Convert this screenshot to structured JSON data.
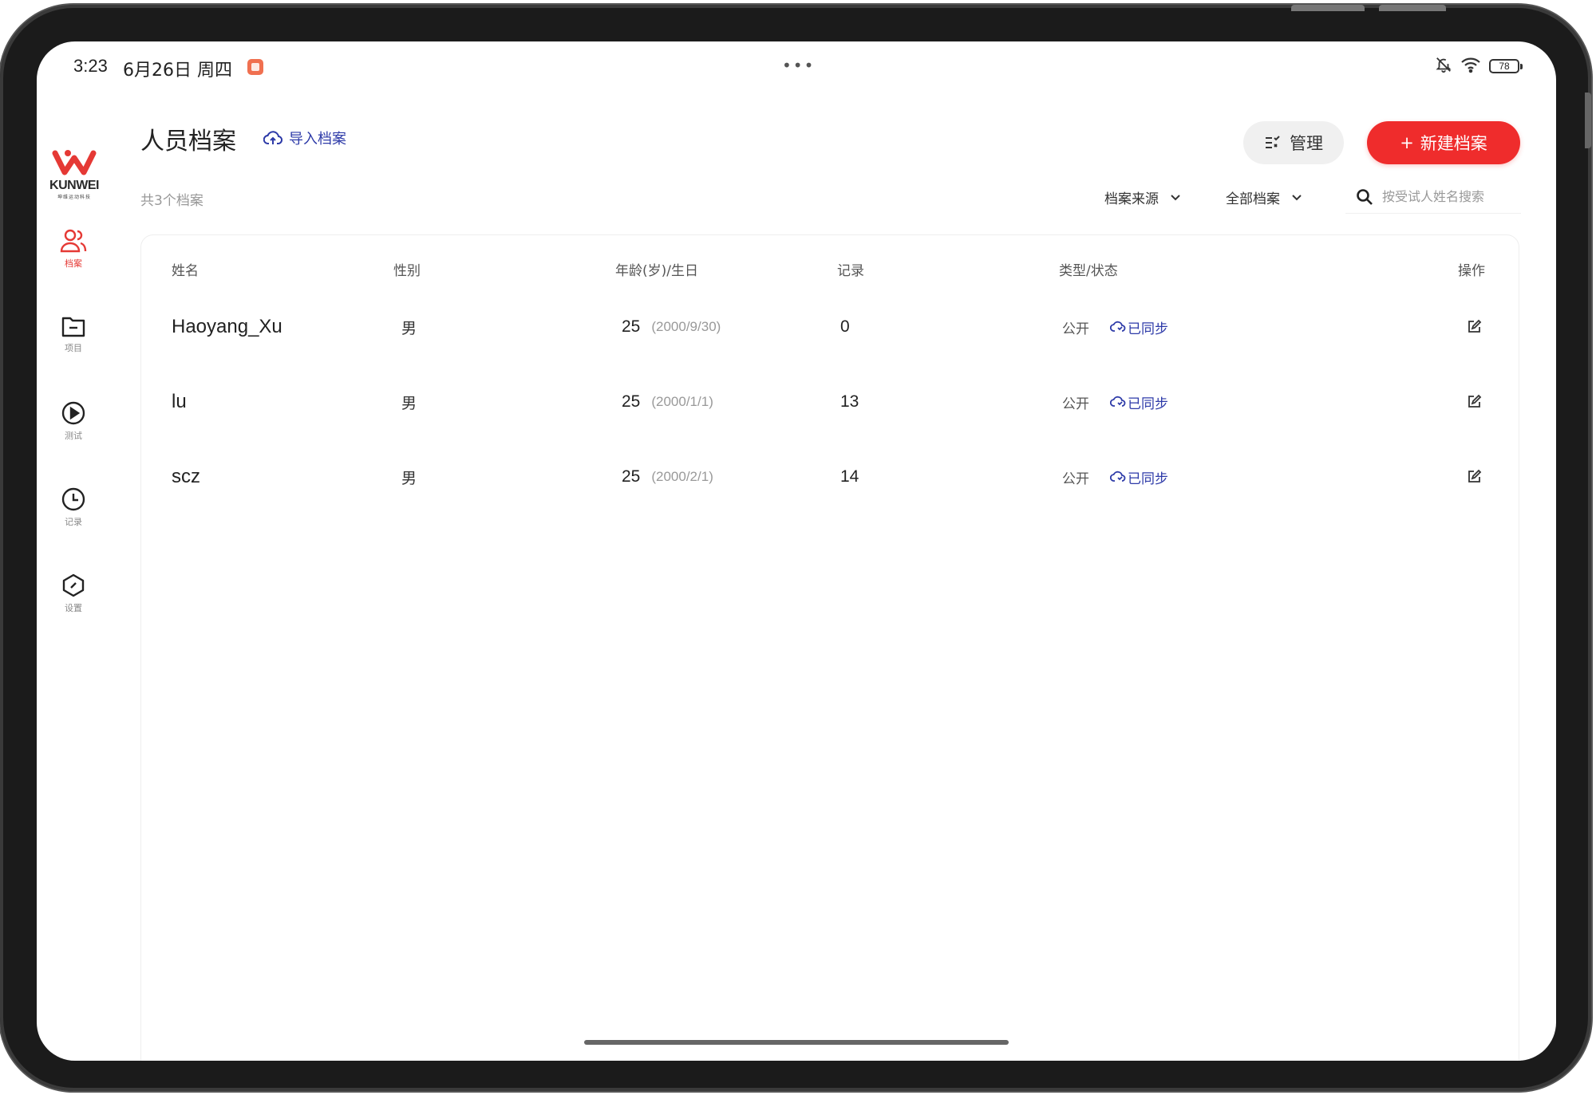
{
  "status_bar": {
    "time": "3:23",
    "date": "6月26日 周四",
    "battery": "78"
  },
  "sidebar": {
    "logo_text": "KUNWEI",
    "logo_sub": "坤维运动科技",
    "items": [
      {
        "label": "档案",
        "icon": "user-group-icon",
        "active": true
      },
      {
        "label": "项目",
        "icon": "folder-icon",
        "active": false
      },
      {
        "label": "测试",
        "icon": "play-circle-icon",
        "active": false
      },
      {
        "label": "记录",
        "icon": "clock-icon",
        "active": false
      },
      {
        "label": "设置",
        "icon": "settings-hexagon-icon",
        "active": false
      }
    ]
  },
  "header": {
    "title": "人员档案",
    "import_label": "导入档案",
    "manage_label": "管理",
    "new_label": "新建档案",
    "new_prefix": "+"
  },
  "toolbar": {
    "count_text": "共3个档案",
    "filter_source": "档案来源",
    "filter_all": "全部档案",
    "search_placeholder": "按受试人姓名搜索"
  },
  "table": {
    "columns": {
      "name": "姓名",
      "gender": "性别",
      "age": "年龄(岁)/生日",
      "records": "记录",
      "type": "类型/状态",
      "actions": "操作"
    },
    "rows": [
      {
        "name": "Haoyang_Xu",
        "gender": "男",
        "age": "25",
        "birthday": "(2000/9/30)",
        "records": "0",
        "type": "公开",
        "status": "已同步"
      },
      {
        "name": "lu",
        "gender": "男",
        "age": "25",
        "birthday": "(2000/1/1)",
        "records": "13",
        "type": "公开",
        "status": "已同步"
      },
      {
        "name": "scz",
        "gender": "男",
        "age": "25",
        "birthday": "(2000/2/1)",
        "records": "14",
        "type": "公开",
        "status": "已同步"
      }
    ]
  },
  "colors": {
    "accent_red": "#ef2c2c",
    "link_blue": "#2d3aa8",
    "muted": "#999999"
  }
}
